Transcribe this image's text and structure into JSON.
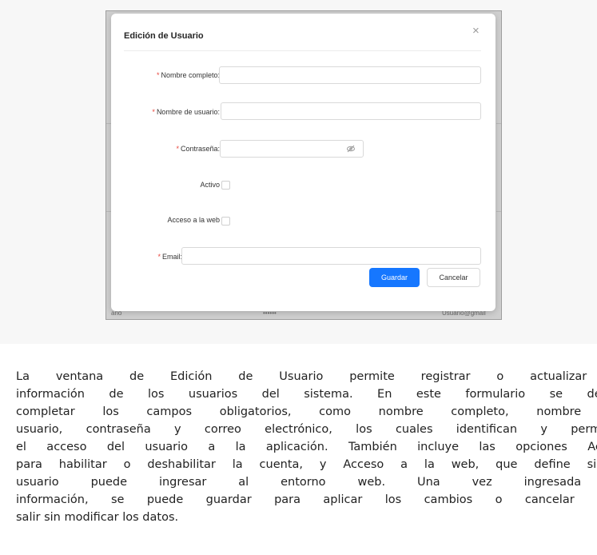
{
  "dialog": {
    "title": "Edición de Usuario",
    "close_symbol": "×",
    "fields": {
      "full_name_label": "Nombre completo",
      "username_label": "Nombre de usuario",
      "password_label": "Contraseña",
      "active_label": "Activo",
      "web_access_label": "Acceso a la web",
      "email_label": "Email",
      "required_mark": "*",
      "separator": ":"
    },
    "buttons": {
      "save": "Guardar",
      "cancel": "Cancelar"
    },
    "icons": {
      "password_toggle": "eye-invisible-icon",
      "close": "close-icon"
    },
    "colors": {
      "primary": "#1677ff",
      "required": "#e8453c"
    }
  },
  "background_fragments": [
    "ario",
    "••••••",
    "Usuario@gmail"
  ],
  "description_lines": [
    "La ventana de Edición de Usuario permite registrar o actualizar la",
    "información de los usuarios del sistema. En este formulario se deben",
    "completar los campos obligatorios, como nombre completo, nombre de",
    "usuario, contraseña y correo electrónico, los cuales identifican y permiten",
    "el acceso del usuario a la aplicación. También incluye las opciones Activo",
    "para habilitar o deshabilitar la cuenta, y Acceso a la web, que define si el",
    "usuario puede ingresar al entorno web. Una vez ingresada la",
    "información, se puede guardar para aplicar los cambios o cancelar para",
    "salir sin modificar los datos."
  ]
}
